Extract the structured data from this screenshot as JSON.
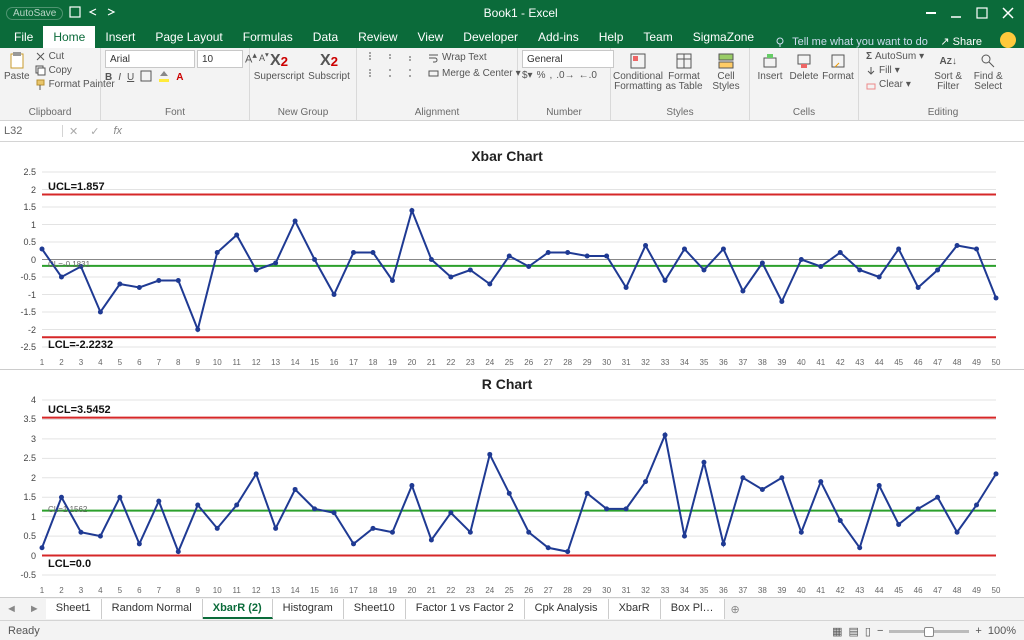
{
  "app": {
    "title": "Book1 - Excel",
    "autosave": "AutoSave",
    "share": "Share"
  },
  "menu": [
    "File",
    "Home",
    "Insert",
    "Page Layout",
    "Formulas",
    "Data",
    "Review",
    "View",
    "Developer",
    "Add-ins",
    "Help",
    "Team",
    "SigmaZone"
  ],
  "menu_active": "Home",
  "tell_me": "Tell me what you want to do",
  "clipboard": {
    "paste": "Paste",
    "cut": "Cut",
    "copy": "Copy",
    "fmtpainter": "Format Painter",
    "label": "Clipboard"
  },
  "font": {
    "name": "Arial",
    "size": "10",
    "label": "Font"
  },
  "newgroup": {
    "super": "Superscript",
    "sub": "Subscript",
    "label": "New Group"
  },
  "alignment": {
    "wrap": "Wrap Text",
    "merge": "Merge & Center",
    "label": "Alignment"
  },
  "number": {
    "fmt": "General",
    "label": "Number"
  },
  "styles": {
    "cond": "Conditional Formatting",
    "fat": "Format as Table",
    "cell": "Cell Styles",
    "label": "Styles"
  },
  "cells": {
    "ins": "Insert",
    "del": "Delete",
    "fmt": "Format",
    "label": "Cells"
  },
  "editing": {
    "sum": "AutoSum",
    "fill": "Fill",
    "clear": "Clear",
    "sort": "Sort & Filter",
    "find": "Find & Select",
    "label": "Editing"
  },
  "namebox": "L32",
  "sheets": [
    "Sheet1",
    "Random Normal",
    "XbarR (2)",
    "Histogram",
    "Sheet10",
    "Factor 1 vs Factor 2",
    "Cpk Analysis",
    "XbarR",
    "Box Pl…"
  ],
  "sheet_active": "XbarR (2)",
  "status": {
    "ready": "Ready",
    "zoom": "100%"
  },
  "chart_data": [
    {
      "type": "line",
      "title": "Xbar Chart",
      "x": [
        1,
        2,
        3,
        4,
        5,
        6,
        7,
        8,
        9,
        10,
        11,
        12,
        13,
        14,
        15,
        16,
        17,
        18,
        19,
        20,
        21,
        22,
        23,
        24,
        25,
        26,
        27,
        28,
        29,
        30,
        31,
        32,
        33,
        34,
        35,
        36,
        37,
        38,
        39,
        40,
        41,
        42,
        43,
        44,
        45,
        46,
        47,
        48,
        49,
        50
      ],
      "values": [
        0.3,
        -0.5,
        -0.2,
        -1.5,
        -0.7,
        -0.8,
        -0.6,
        -0.6,
        -2.0,
        0.2,
        0.7,
        -0.3,
        -0.1,
        1.1,
        0.0,
        -1.0,
        0.2,
        0.2,
        -0.6,
        1.4,
        0.0,
        -0.5,
        -0.3,
        -0.7,
        0.1,
        -0.2,
        0.2,
        0.2,
        0.1,
        0.1,
        -0.8,
        0.4,
        -0.6,
        0.3,
        -0.3,
        0.3,
        -0.9,
        -0.1,
        -1.2,
        0.0,
        -0.2,
        0.2,
        -0.3,
        -0.5,
        0.3,
        -0.8,
        -0.3,
        0.4,
        0.3,
        -1.1
      ],
      "ucl": 1.857,
      "cl": -0.1831,
      "lcl": -2.2232,
      "ucl_label": "UCL=1.857",
      "lcl_label": "LCL=-2.2232",
      "cl_label": "CL=-0.1831",
      "ylim": [
        -2.5,
        2.5
      ],
      "yticks": [
        -2.5,
        -2,
        -1.5,
        -1,
        -0.5,
        0,
        0.5,
        1,
        1.5,
        2,
        2.5
      ]
    },
    {
      "type": "line",
      "title": "R Chart",
      "x": [
        1,
        2,
        3,
        4,
        5,
        6,
        7,
        8,
        9,
        10,
        11,
        12,
        13,
        14,
        15,
        16,
        17,
        18,
        19,
        20,
        21,
        22,
        23,
        24,
        25,
        26,
        27,
        28,
        29,
        30,
        31,
        32,
        33,
        34,
        35,
        36,
        37,
        38,
        39,
        40,
        41,
        42,
        43,
        44,
        45,
        46,
        47,
        48,
        49,
        50
      ],
      "values": [
        0.2,
        1.5,
        0.6,
        0.5,
        1.5,
        0.3,
        1.4,
        0.1,
        1.3,
        0.7,
        1.3,
        2.1,
        0.7,
        1.7,
        1.2,
        1.1,
        0.3,
        0.7,
        0.6,
        1.8,
        0.4,
        1.1,
        0.6,
        2.6,
        1.6,
        0.6,
        0.2,
        0.1,
        1.6,
        1.2,
        1.2,
        1.9,
        3.1,
        0.5,
        2.4,
        0.3,
        2.0,
        1.7,
        2.0,
        0.6,
        1.9,
        0.9,
        0.2,
        1.8,
        0.8,
        1.2,
        1.5,
        0.6,
        1.3,
        2.1
      ],
      "ucl": 3.5452,
      "cl": 1.1562,
      "lcl": 0.0,
      "ucl_label": "UCL=3.5452",
      "lcl_label": "LCL=0.0",
      "cl_label": "CL=1.1562",
      "ylim": [
        -0.5,
        4
      ],
      "yticks": [
        -0.5,
        0,
        0.5,
        1,
        1.5,
        2,
        2.5,
        3,
        3.5,
        4
      ]
    }
  ]
}
